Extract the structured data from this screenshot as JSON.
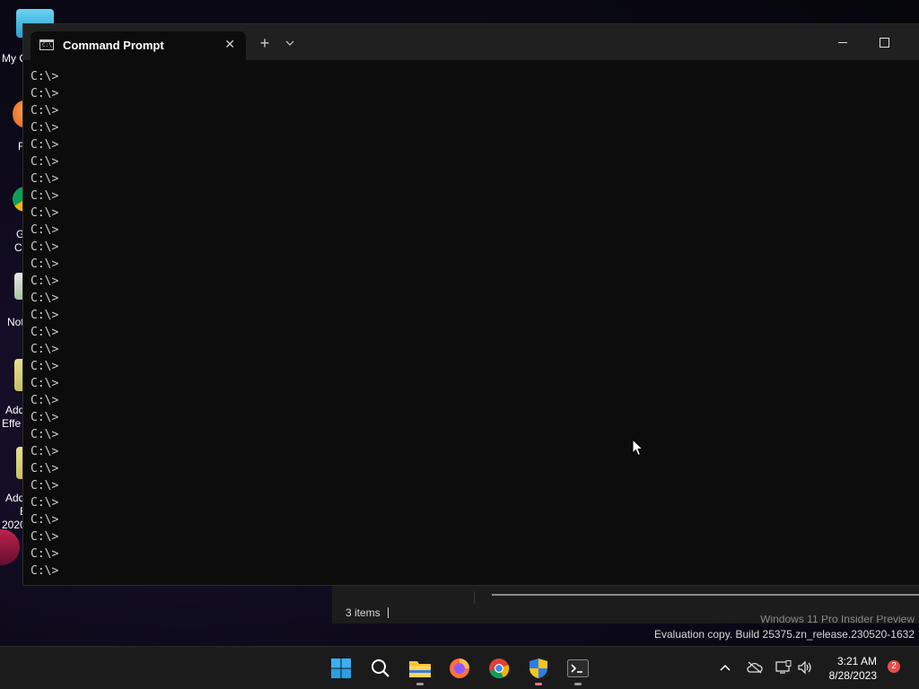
{
  "desktop": {
    "icons": [
      {
        "label": "My C",
        "icon": "computer-icon"
      },
      {
        "label": "F",
        "icon": "firefox-icon"
      },
      {
        "label": "G",
        "label2": "C",
        "icon": "chrome-icon"
      },
      {
        "label": "Not",
        "icon": "notepad-icon"
      },
      {
        "label": "Add",
        "label2": "Effe",
        "icon": "adobe-after-effects-icon"
      },
      {
        "label": "Add",
        "label2": "E",
        "label3": "2020",
        "icon": "adobe-icon"
      }
    ],
    "watermark": {
      "line1": "Windows 11 Pro Insider Preview",
      "line2": "Evaluation copy. Build 25375.zn_release.230520-1632"
    }
  },
  "explorer": {
    "status": "3 items"
  },
  "terminal": {
    "tab_title": "Command Prompt",
    "tab_icon": "cmd-icon",
    "lines": [
      "C:\\>",
      "C:\\>",
      "C:\\>",
      "C:\\>",
      "C:\\>",
      "C:\\>",
      "C:\\>",
      "C:\\>",
      "C:\\>",
      "C:\\>",
      "C:\\>",
      "C:\\>",
      "C:\\>",
      "C:\\>",
      "C:\\>",
      "C:\\>",
      "C:\\>",
      "C:\\>",
      "C:\\>",
      "C:\\>",
      "C:\\>",
      "C:\\>",
      "C:\\>",
      "C:\\>",
      "C:\\>",
      "C:\\>",
      "C:\\>",
      "C:\\>",
      "C:\\>",
      "C:\\>"
    ]
  },
  "taskbar": {
    "apps": [
      "start-icon",
      "search-icon",
      "file-explorer-icon",
      "firefox-icon",
      "chrome-icon",
      "security-shield-icon",
      "terminal-icon"
    ],
    "clock": {
      "time": "3:21 AM",
      "date": "8/28/2023"
    },
    "notification_count": "2"
  },
  "colors": {
    "terminal_bg": "#0c0c0c",
    "titlebar_bg": "#202020",
    "text": "#cccccc",
    "badge": "#e74c4c"
  }
}
